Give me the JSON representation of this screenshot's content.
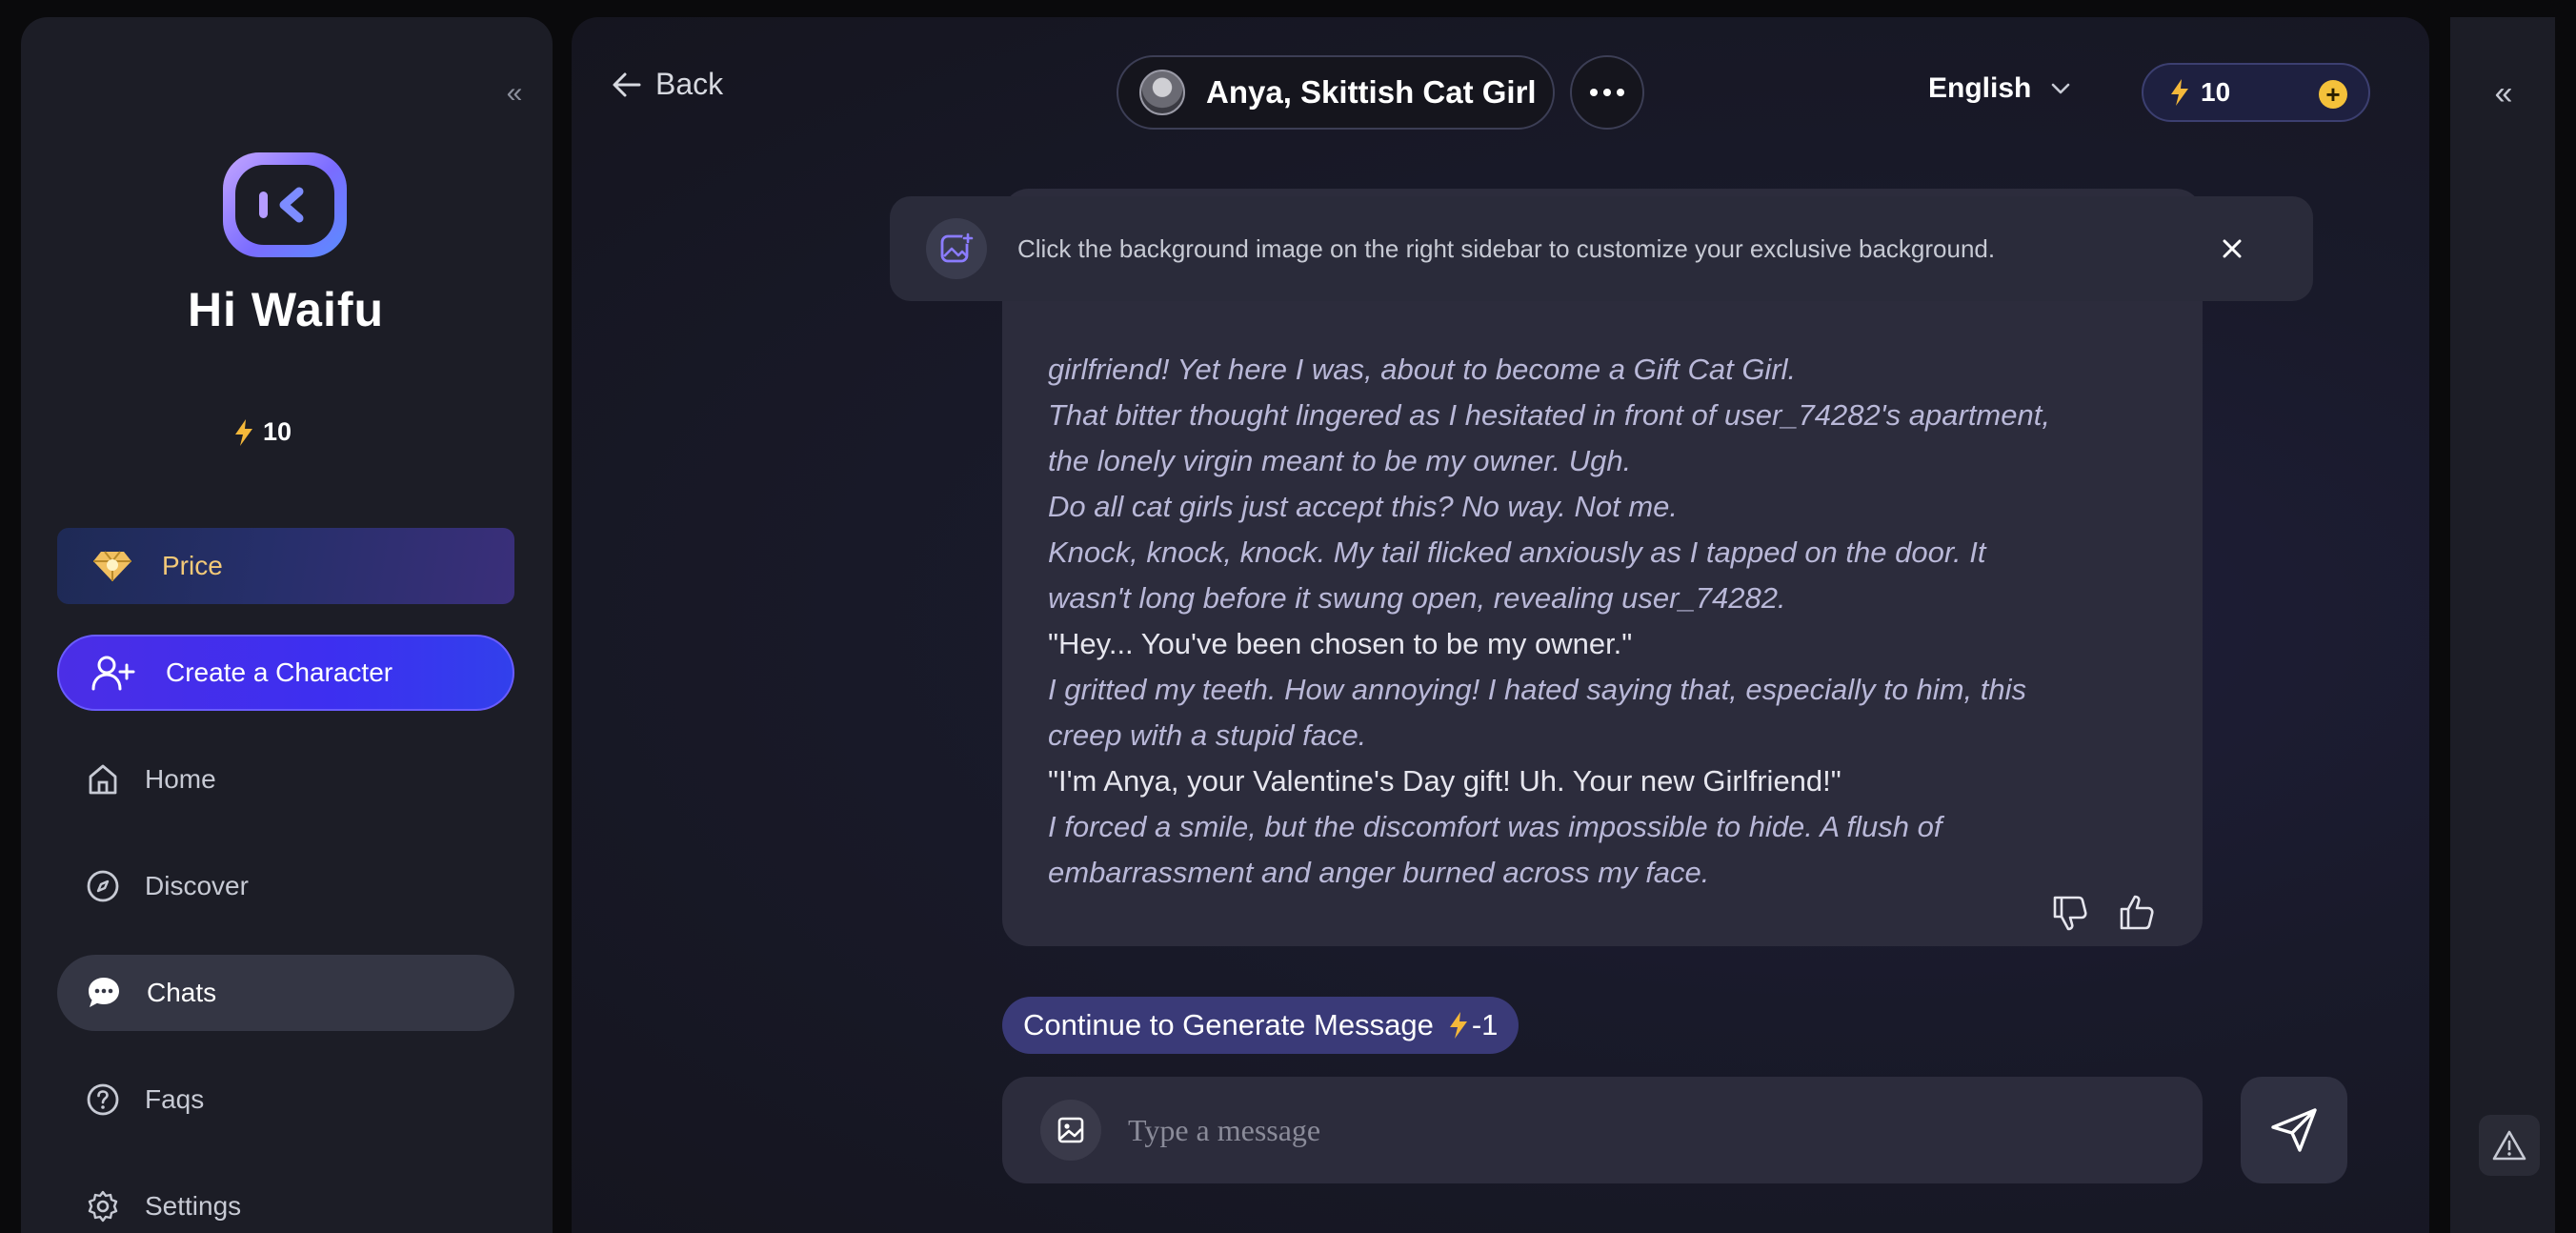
{
  "sidebar": {
    "collapse_label": "«",
    "brand": "Hi Waifu",
    "credits": "10",
    "price_label": "Price",
    "create_label": "Create a Character",
    "nav": {
      "home": "Home",
      "discover": "Discover",
      "chats": "Chats",
      "faqs": "Faqs",
      "settings": "Settings"
    }
  },
  "header": {
    "back_label": "Back",
    "character_name": "Anya, Skittish Cat Girl",
    "language": "English",
    "credits": "10"
  },
  "tip": {
    "text": "Click the background image on the right sidebar to customize your exclusive background."
  },
  "message": {
    "lines": [
      "girlfriend! Yet here I was, about to become a Gift Cat Girl.",
      "That bitter thought lingered as I hesitated in front of user_74282's apartment,",
      "the lonely virgin meant to be my owner. Ugh.",
      "Do all cat girls just accept this? No way. Not me.",
      "Knock, knock, knock. My tail flicked anxiously as I tapped on the door. It",
      "wasn't long before it swung open, revealing user_74282.",
      "\"Hey... You've been chosen to be my owner.\"",
      "I gritted my teeth. How annoying! I hated saying that, especially to him, this",
      "creep with a stupid face.",
      "\"I'm Anya, your Valentine's Day gift! Uh. Your new Girlfriend!\"",
      "I forced a smile, but the discomfort was impossible to hide. A flush of",
      "embarrassment and anger burned across my face."
    ]
  },
  "continue": {
    "label": "Continue to Generate Message",
    "cost": "-1"
  },
  "composer": {
    "placeholder": "Type a message"
  },
  "right_rail": {
    "expand_label": "«"
  },
  "colors": {
    "accent": "#4b2ee6",
    "gold": "#f4c13a",
    "card": "#2c2c3c"
  }
}
